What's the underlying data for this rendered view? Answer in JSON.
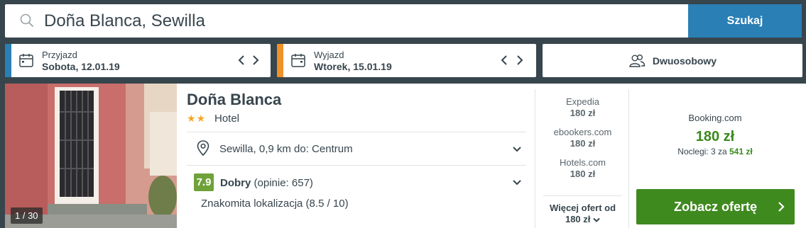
{
  "search": {
    "value": "Doña Blanca, Sewilla",
    "button_label": "Szukaj",
    "icon": "search-icon"
  },
  "checkin": {
    "label": "Przyjazd",
    "value": "Sobota, 12.01.19",
    "accent_color": "#2a7fb5"
  },
  "checkout": {
    "label": "Wyjazd",
    "value": "Wtorek, 15.01.19",
    "accent_color": "#f0912a"
  },
  "room": {
    "label": "Dwuosobowy",
    "icon": "guests-icon"
  },
  "hotel": {
    "photo_counter": "1 / 30",
    "name": "Doña Blanca",
    "stars": 2,
    "type": "Hotel",
    "location": "Sewilla, 0,9 km do: Centrum",
    "rating": {
      "score": "7.9",
      "label": "Dobry",
      "reviews": "(opinie: 657)",
      "sub": "Znakomita lokalizacja (8.5 / 10)",
      "color": "#6fa239"
    }
  },
  "offers": [
    {
      "site": "Expedia",
      "price": "180 zł"
    },
    {
      "site": "ebookers.com",
      "price": "180 zł"
    },
    {
      "site": "Hotels.com",
      "price": "180 zł"
    }
  ],
  "more_offers": {
    "label": "Więcej ofert od",
    "price": "180 zł"
  },
  "best_offer": {
    "site": "Booking.com",
    "price": "180 zł",
    "nights_label": "Noclegi: 3 za",
    "nights_total": "541 zł",
    "cta": "Zobacz ofertę",
    "price_color": "#3a8a1c",
    "cta_color": "#3f8a1f"
  }
}
